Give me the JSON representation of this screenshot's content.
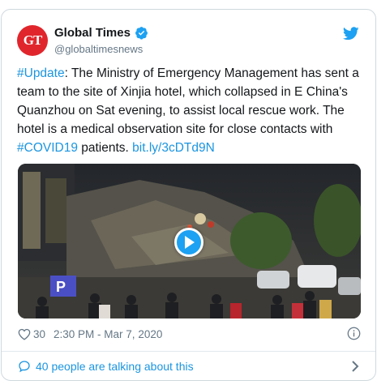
{
  "author": {
    "display_name": "Global Times",
    "handle": "@globaltimesnews",
    "avatar_text": "GT"
  },
  "tweet": {
    "hashtag1": "#Update",
    "text1": ": The Ministry of Emergency Management has sent a team to the site of Xinjia hotel, which collapsed in E China's Quanzhou on Sat evening, to assist local rescue work. The hotel is a medical observation site for close contacts with ",
    "hashtag2": "#COVID19",
    "text2": " patients. ",
    "link": "bit.ly/3cDTd9N"
  },
  "meta": {
    "likes": "30",
    "timestamp": "2:30 PM - Mar 7, 2020"
  },
  "conversation": {
    "label": "40 people are talking about this"
  },
  "colors": {
    "link": "#1b95e0",
    "brand": "#1da1f2",
    "avatar_bg": "#e0262c"
  },
  "icons": [
    "verified-icon",
    "twitter-bird-icon",
    "play-icon",
    "heart-icon",
    "info-icon",
    "speech-bubble-icon",
    "chevron-right-icon"
  ]
}
